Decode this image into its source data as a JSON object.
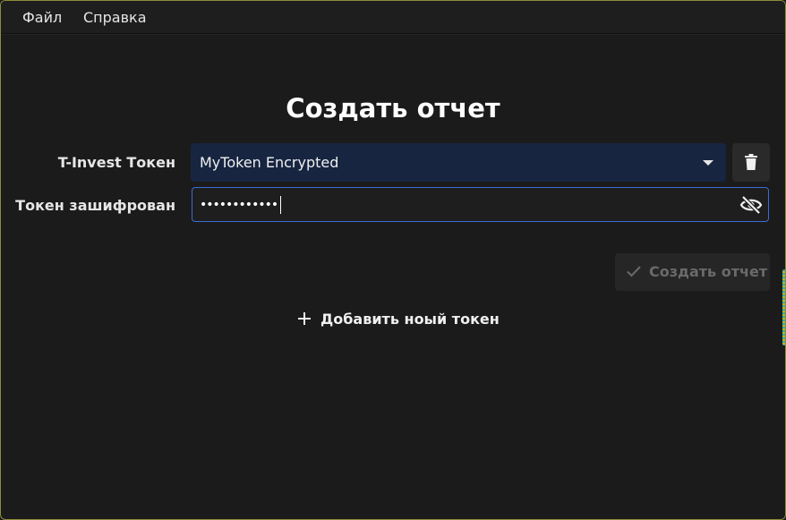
{
  "menu": {
    "file": "Файл",
    "help": "Справка"
  },
  "page": {
    "title": "Создать отчет"
  },
  "token_select": {
    "label": "T-Invest Токен",
    "value": "MyToken Encrypted",
    "icon": "chevron-down-icon"
  },
  "delete_button": {
    "icon": "trash-icon"
  },
  "password": {
    "label": "Токен зашифрован",
    "value": "••••••••••••",
    "toggle_icon": "eye-off-icon"
  },
  "create_button": {
    "label": "Создать отчет",
    "icon": "check-icon",
    "enabled": false
  },
  "add_token": {
    "label": "Добавить ноый токен",
    "icon": "plus-icon"
  },
  "colors": {
    "background": "#1b1b1b",
    "select_bg": "#172541",
    "focus_border": "#3d6cd6",
    "disabled_text": "#6a6a6a"
  }
}
